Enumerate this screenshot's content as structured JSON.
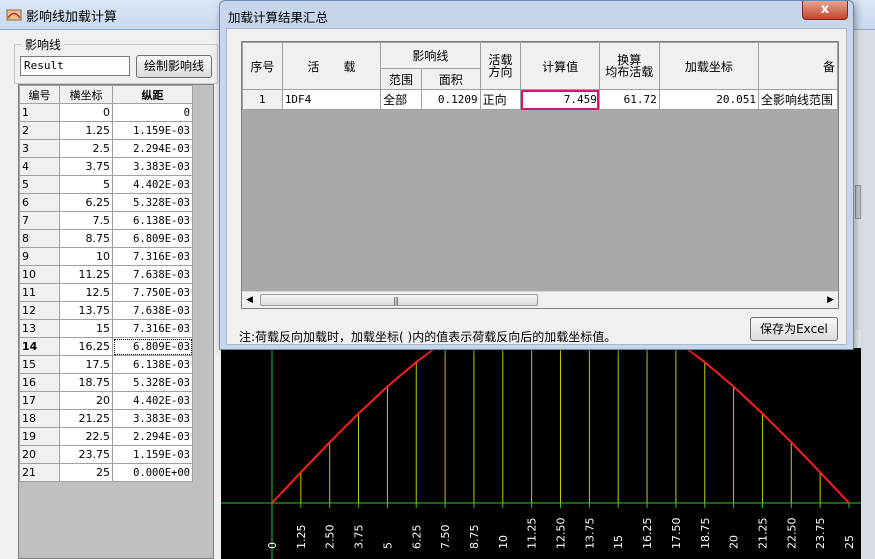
{
  "main_window": {
    "title": "影响线加载计算",
    "group_label": "影响线",
    "result_input_value": "Result",
    "draw_button_label": "绘制影响线"
  },
  "left_grid": {
    "headers": [
      "编号",
      "横坐标",
      "纵距"
    ],
    "active_row": 14,
    "rows": [
      [
        "1",
        "0",
        "0"
      ],
      [
        "2",
        "1.25",
        "1.159E-03"
      ],
      [
        "3",
        "2.5",
        "2.294E-03"
      ],
      [
        "4",
        "3.75",
        "3.383E-03"
      ],
      [
        "5",
        "5",
        "4.402E-03"
      ],
      [
        "6",
        "6.25",
        "5.328E-03"
      ],
      [
        "7",
        "7.5",
        "6.138E-03"
      ],
      [
        "8",
        "8.75",
        "6.809E-03"
      ],
      [
        "9",
        "10",
        "7.316E-03"
      ],
      [
        "10",
        "11.25",
        "7.638E-03"
      ],
      [
        "11",
        "12.5",
        "7.750E-03"
      ],
      [
        "12",
        "13.75",
        "7.638E-03"
      ],
      [
        "13",
        "15",
        "7.316E-03"
      ],
      [
        "14",
        "16.25",
        "6.809E-03"
      ],
      [
        "15",
        "17.5",
        "6.138E-03"
      ],
      [
        "16",
        "18.75",
        "5.328E-03"
      ],
      [
        "17",
        "20",
        "4.402E-03"
      ],
      [
        "18",
        "21.25",
        "3.383E-03"
      ],
      [
        "19",
        "22.5",
        "2.294E-03"
      ],
      [
        "20",
        "23.75",
        "1.159E-03"
      ],
      [
        "21",
        "25",
        "0.000E+00"
      ]
    ]
  },
  "plot": {
    "x_ticks": [
      "0",
      "1.25",
      "2.50",
      "3.75",
      "5",
      "6.25",
      "7.50",
      "8.75",
      "10",
      "11.25",
      "12.50",
      "13.75",
      "15",
      "16.25",
      "17.50",
      "18.75",
      "20",
      "21.25",
      "22.50",
      "23.75",
      "25"
    ],
    "x_values": [
      0,
      1.25,
      2.5,
      3.75,
      5,
      6.25,
      7.5,
      8.75,
      10,
      11.25,
      12.5,
      13.75,
      15,
      16.25,
      17.5,
      18.75,
      20,
      21.25,
      22.5,
      23.75,
      25
    ],
    "y_values": [
      0,
      0.001159,
      0.002294,
      0.003383,
      0.004402,
      0.005328,
      0.006138,
      0.006809,
      0.007316,
      0.007638,
      0.00775,
      0.007638,
      0.007316,
      0.006809,
      0.006138,
      0.005328,
      0.004402,
      0.003383,
      0.002294,
      0.001159,
      0
    ],
    "colors": {
      "curve": "#ff2020",
      "ordinates": "#c8c800",
      "axis": "#28c828",
      "tick_text": "#ffffff",
      "background": "#000000"
    }
  },
  "dialog": {
    "title": "加载计算结果汇总",
    "close_label": "x",
    "headers": {
      "seq": "序号",
      "live_load": "活　　载",
      "influence_line": "影响线",
      "range": "范围",
      "area": "面积",
      "load_dir_1": "活载",
      "load_dir_2": "方向",
      "calc_value": "计算值",
      "equiv_1": "换算",
      "equiv_2": "均布活载",
      "load_coord": "加载坐标",
      "remark_partial": "备"
    },
    "rows": [
      {
        "seq": "1",
        "load": "1DF4",
        "range": "全部",
        "area": "0.1209",
        "direction": "正向",
        "calc_value": "7.459",
        "equiv": "61.72",
        "coord": "20.051",
        "remark": "全影响线范围"
      }
    ],
    "note": "注:荷载反向加载时，加载坐标( )内的值表示荷载反向后的加载坐标值。",
    "save_button_label": "保存为Excel"
  }
}
